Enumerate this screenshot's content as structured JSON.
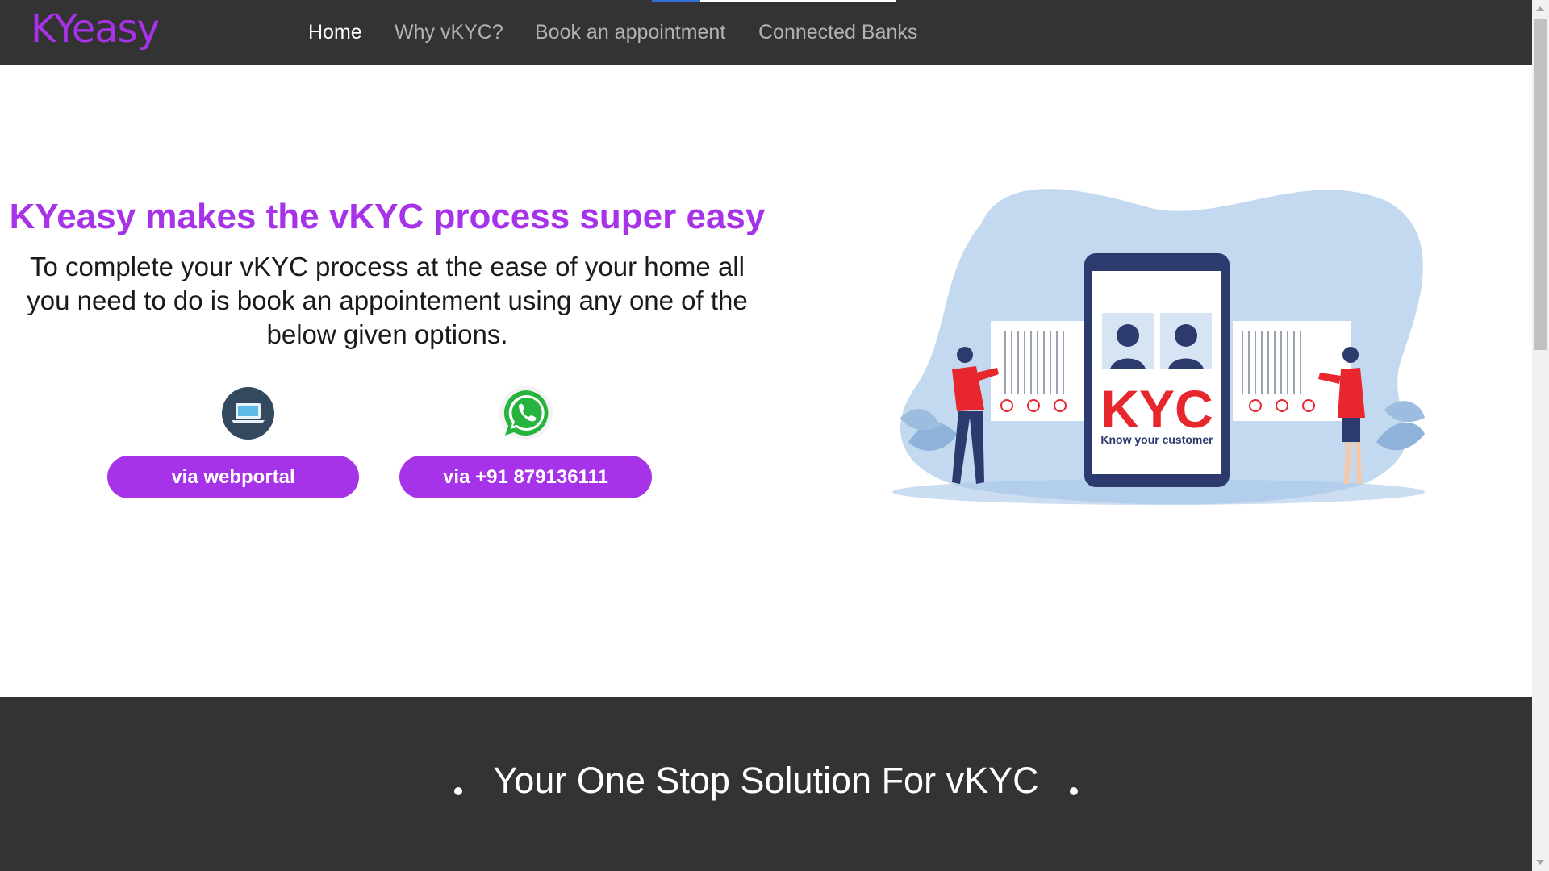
{
  "nav": {
    "brand": "KYeasy",
    "links": [
      {
        "label": "Home",
        "active": true
      },
      {
        "label": "Why vKYC?",
        "active": false
      },
      {
        "label": "Book an appointment",
        "active": false
      },
      {
        "label": "Connected Banks",
        "active": false
      }
    ]
  },
  "hero": {
    "title": "KYeasy makes the vKYC process super easy",
    "subtitle": "To complete your vKYC process at the ease of your home all you need to do is book an appointement using any one of the below given options.",
    "options": [
      {
        "icon": "laptop-icon",
        "button": "via webportal"
      },
      {
        "icon": "whatsapp-icon",
        "button": "via +91 879136111"
      }
    ],
    "illustration": {
      "kyc_text": "KYC",
      "kyc_caption": "Know your customer"
    }
  },
  "band": {
    "tagline": "Your One Stop Solution For vKYC"
  },
  "colors": {
    "brand_purple": "#a633e8",
    "nav_bg": "#333333",
    "kyc_red": "#e8262d",
    "blob_blue": "#c3d9ef",
    "whatsapp_green": "#27b43e"
  }
}
